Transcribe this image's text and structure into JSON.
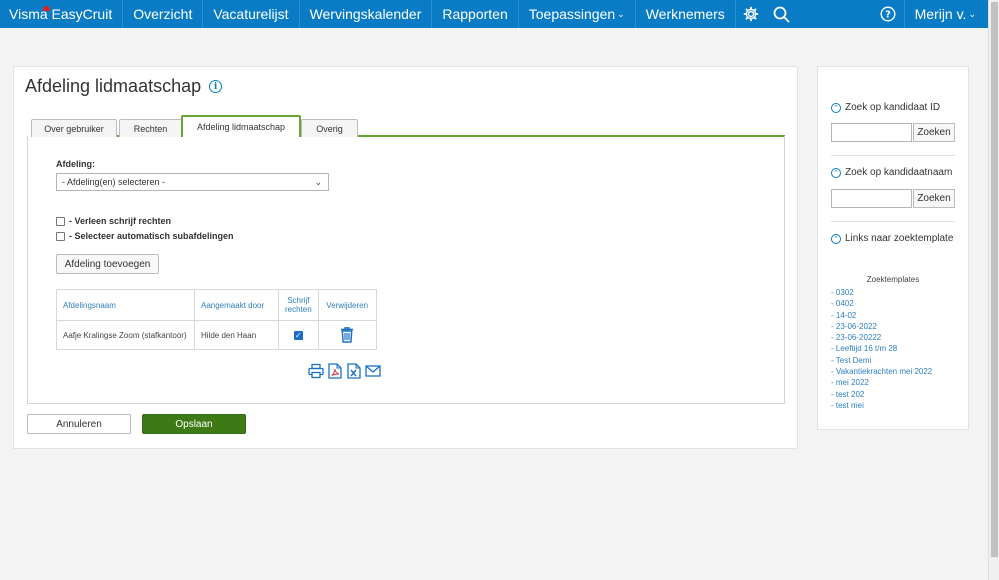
{
  "nav": {
    "logo": "Visma EasyCruit",
    "items": [
      "Overzicht",
      "Vacaturelijst",
      "Wervingskalender",
      "Rapporten",
      "Toepassingen",
      "Werknemers"
    ],
    "user": "Merijn v."
  },
  "page": {
    "title": "Afdeling lidmaatschap"
  },
  "tabs": [
    "Over gebruiker",
    "Rechten",
    "Afdeling lidmaatschap",
    "Overig"
  ],
  "form": {
    "afdeling_label": "Afdeling:",
    "afdeling_select": "- Afdeling(en) selecteren -",
    "check_write": "- Verleen schrijf rechten",
    "check_sub": "- Selecteer automatisch subafdelingen",
    "add_button": "Afdeling toevoegen"
  },
  "grid": {
    "headers": [
      "Afdelingsnaam",
      "Aangemaakt door",
      "Schrijf rechten",
      "Verwijderen"
    ],
    "rows": [
      {
        "name": "Aafje Kralingse Zoom (stafkantoor)",
        "created_by": "Hilde den Haan",
        "write": true
      }
    ]
  },
  "actions": {
    "cancel": "Annuleren",
    "save": "Opslaan"
  },
  "side": {
    "search_id": "Zoek op kandidaat ID",
    "search_name": "Zoek op kandidaatnaam",
    "search_btn": "Zoeken",
    "links_title": "Links naar zoektemplate",
    "templates_title": "Zoektemplates",
    "templates": [
      "- 0302",
      "- 0402",
      "- 14-02",
      "- 23-06-2022",
      "- 23-06-20222",
      "- Leeftijd 16 t/m 28",
      "- Test Demi",
      "- Vakantiekrachten mei 2022",
      "- mei 2022",
      "- test 202",
      "- test mei"
    ]
  },
  "colors": {
    "nav_bg": "#0a7cc6",
    "tab_accent": "#68a533",
    "save_bg": "#3d7a16",
    "link": "#2d7fc0"
  }
}
